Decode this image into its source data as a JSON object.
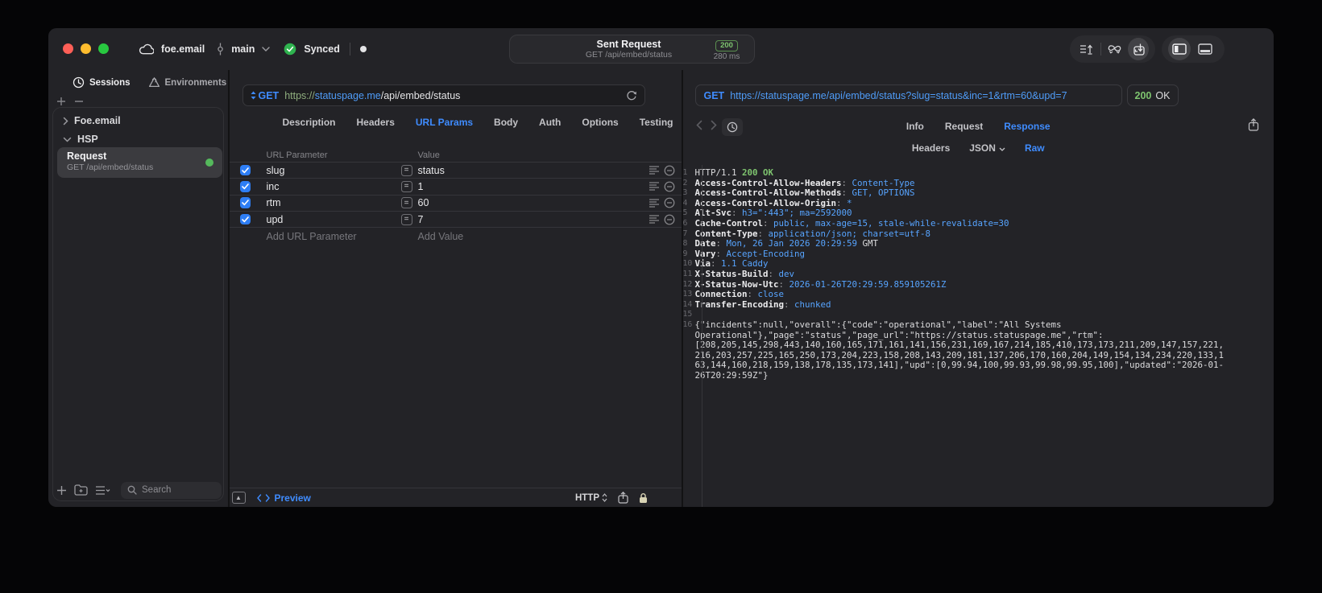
{
  "titlebar": {
    "project": "foe.email",
    "branch": "main",
    "sync_status": "Synced",
    "request_title": "Sent Request",
    "request_subtitle": "GET /api/embed/status",
    "status_badge": "200",
    "duration": "280 ms"
  },
  "colors": {
    "accent_blue": "#3f8cff",
    "success_green": "#7ec46f",
    "traffic_red": "#ff5f57",
    "traffic_yellow": "#febc2e",
    "traffic_green": "#28c840"
  },
  "sidebar": {
    "tabs": [
      {
        "label": "Sessions",
        "icon": "history-icon",
        "active": true
      },
      {
        "label": "Environments",
        "icon": "environments-icon",
        "active": false
      }
    ],
    "tree": [
      {
        "label": "Foe.email",
        "expanded": false
      },
      {
        "label": "HSP",
        "expanded": true
      }
    ],
    "request_item": {
      "title": "Request",
      "subtitle": "GET /api/embed/status"
    },
    "search_placeholder": "Search"
  },
  "request_panel": {
    "method": "GET",
    "url": {
      "scheme": "https://",
      "host": "statuspage.me",
      "path": "/api/embed/status"
    },
    "tabs": [
      "Description",
      "Headers",
      "URL Params",
      "Body",
      "Auth",
      "Options",
      "Testing"
    ],
    "active_tab": "URL Params",
    "params_table": {
      "columns": [
        "URL Parameter",
        "Value"
      ],
      "rows": [
        {
          "enabled": true,
          "name": "slug",
          "value": "status"
        },
        {
          "enabled": true,
          "name": "inc",
          "value": "1"
        },
        {
          "enabled": true,
          "name": "rtm",
          "value": "60"
        },
        {
          "enabled": true,
          "name": "upd",
          "value": "7"
        }
      ],
      "add_param_placeholder": "Add URL Parameter",
      "add_value_placeholder": "Add Value"
    },
    "footer": {
      "preview_label": "Preview",
      "protocol_label": "HTTP"
    }
  },
  "response_panel": {
    "method": "GET",
    "url": "https://statuspage.me/api/embed/status?slug=status&inc=1&rtm=60&upd=7",
    "status_code": "200",
    "status_text": "OK",
    "tabs": [
      "Info",
      "Request",
      "Response"
    ],
    "active_tab": "Response",
    "subtabs": [
      "Headers",
      "JSON",
      "Raw"
    ],
    "active_subtab": "Raw",
    "body_lines": [
      {
        "n": "1",
        "segs": [
          {
            "t": "HTTP/1.1 ",
            "c": "plain"
          },
          {
            "t": "200 OK",
            "c": "green"
          }
        ]
      },
      {
        "n": "2",
        "segs": [
          {
            "t": "Access-Control-Allow-Headers",
            "c": "key"
          },
          {
            "t": ": ",
            "c": "dim"
          },
          {
            "t": "Content-Type",
            "c": "val"
          }
        ]
      },
      {
        "n": "3",
        "segs": [
          {
            "t": "Access-Control-Allow-Methods",
            "c": "key"
          },
          {
            "t": ": ",
            "c": "dim"
          },
          {
            "t": "GET, OPTIONS",
            "c": "val"
          }
        ]
      },
      {
        "n": "4",
        "segs": [
          {
            "t": "Access-Control-Allow-Origin",
            "c": "key"
          },
          {
            "t": ": ",
            "c": "dim"
          },
          {
            "t": "*",
            "c": "val"
          }
        ]
      },
      {
        "n": "5",
        "segs": [
          {
            "t": "Alt-Svc",
            "c": "key"
          },
          {
            "t": ": ",
            "c": "dim"
          },
          {
            "t": "h3=\":443\"; ma=2592000",
            "c": "val"
          }
        ]
      },
      {
        "n": "6",
        "segs": [
          {
            "t": "Cache-Control",
            "c": "key"
          },
          {
            "t": ": ",
            "c": "dim"
          },
          {
            "t": "public, max-age=15, stale-while-revalidate=30",
            "c": "val"
          }
        ]
      },
      {
        "n": "7",
        "segs": [
          {
            "t": "Content-Type",
            "c": "key"
          },
          {
            "t": ": ",
            "c": "dim"
          },
          {
            "t": "application/json; charset=utf-8",
            "c": "val"
          }
        ]
      },
      {
        "n": "8",
        "segs": [
          {
            "t": "Date",
            "c": "key"
          },
          {
            "t": ": ",
            "c": "dim"
          },
          {
            "t": "Mon, 26 Jan 2026 20:29:59",
            "c": "val"
          },
          {
            "t": " GMT",
            "c": "plain"
          }
        ]
      },
      {
        "n": "9",
        "segs": [
          {
            "t": "Vary",
            "c": "key"
          },
          {
            "t": ": ",
            "c": "dim"
          },
          {
            "t": "Accept-Encoding",
            "c": "val"
          }
        ]
      },
      {
        "n": "10",
        "segs": [
          {
            "t": "Via",
            "c": "key"
          },
          {
            "t": ": ",
            "c": "dim"
          },
          {
            "t": "1.1 Caddy",
            "c": "val"
          }
        ]
      },
      {
        "n": "11",
        "segs": [
          {
            "t": "X-Status-Build",
            "c": "key"
          },
          {
            "t": ": ",
            "c": "dim"
          },
          {
            "t": "dev",
            "c": "val"
          }
        ]
      },
      {
        "n": "12",
        "segs": [
          {
            "t": "X-Status-Now-Utc",
            "c": "key"
          },
          {
            "t": ": ",
            "c": "dim"
          },
          {
            "t": "2026-01-26T20:29:59.859105261Z",
            "c": "val"
          }
        ]
      },
      {
        "n": "13",
        "segs": [
          {
            "t": "Connection",
            "c": "key"
          },
          {
            "t": ": ",
            "c": "dim"
          },
          {
            "t": "close",
            "c": "val"
          }
        ]
      },
      {
        "n": "14",
        "segs": [
          {
            "t": "Transfer-Encoding",
            "c": "key"
          },
          {
            "t": ": ",
            "c": "dim"
          },
          {
            "t": "chunked",
            "c": "val"
          }
        ]
      },
      {
        "n": "15",
        "segs": []
      },
      {
        "n": "16",
        "segs": [
          {
            "t": "{\"incidents\":null,\"overall\":{\"code\":\"operational\",\"label\":\"All Systems Operational\"},\"page\":\"status\",\"page_url\":\"https://status.statuspage.me\",\"rtm\":[208,205,145,298,443,140,160,165,171,161,141,156,231,169,167,214,185,410,173,173,211,209,147,157,221,216,203,257,225,165,250,173,204,223,158,208,143,209,181,137,206,170,160,204,149,154,134,234,220,133,163,144,160,218,159,138,178,135,173,141],\"upd\":[0,99.94,100,99.93,99.98,99.95,100],\"updated\":\"2026-01-26T20:29:59Z\"}",
            "c": "plain"
          }
        ]
      }
    ]
  }
}
